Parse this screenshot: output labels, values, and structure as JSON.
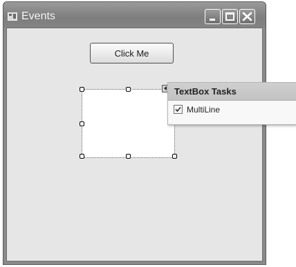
{
  "window": {
    "title": "Events",
    "icon": "form-icon"
  },
  "title_bar_buttons": [
    "minimize-icon",
    "maximize-icon",
    "close-icon"
  ],
  "form": {
    "button_label": "Click Me"
  },
  "smart_tag_panel": {
    "title": "TextBox Tasks",
    "options": [
      {
        "label": "MultiLine",
        "checked": true
      }
    ]
  }
}
